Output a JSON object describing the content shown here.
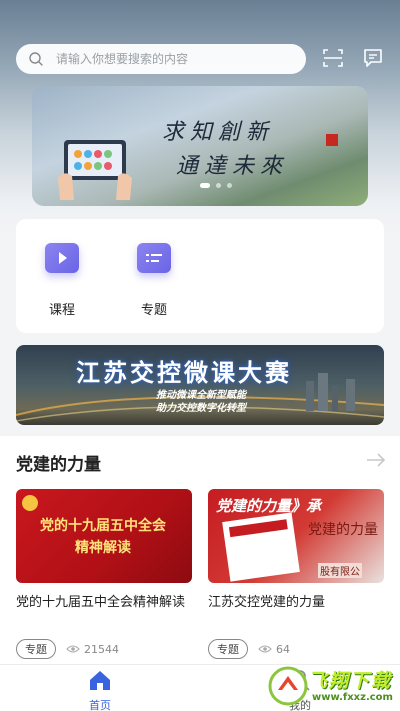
{
  "header": {
    "search_placeholder": "请输入你想要搜索的内容"
  },
  "banner": {
    "line1": "求知創新",
    "line2": "通達未來"
  },
  "quick_entries": [
    {
      "label": "课程",
      "icon": "play-icon"
    },
    {
      "label": "专题",
      "icon": "list-icon"
    }
  ],
  "promo": {
    "title": "江苏交控微课大赛",
    "sub1": "推动微课全新型赋能",
    "sub2": "助力交控数字化转型"
  },
  "section": {
    "title": "党建的力量",
    "cards": [
      {
        "thumb_text": "党的十九届五中全会精神解读",
        "title": "党的十九届五中全会精神解读",
        "tag": "专题",
        "views": "21544"
      },
      {
        "thumb_text": "党建的力量》承",
        "thumb_text2": "党建的力量",
        "thumb_text3": "股有限公",
        "title": "江苏交控党建的力量",
        "tag": "专题",
        "views": "64"
      }
    ]
  },
  "tabbar": {
    "home_label": "首页",
    "mine_label": "我的"
  },
  "watermark": {
    "main": "飞翔下载",
    "sub": "www.fxxz.com"
  },
  "colors": {
    "accent": "#3a63e0",
    "icon_purple": "#6a64e6"
  }
}
